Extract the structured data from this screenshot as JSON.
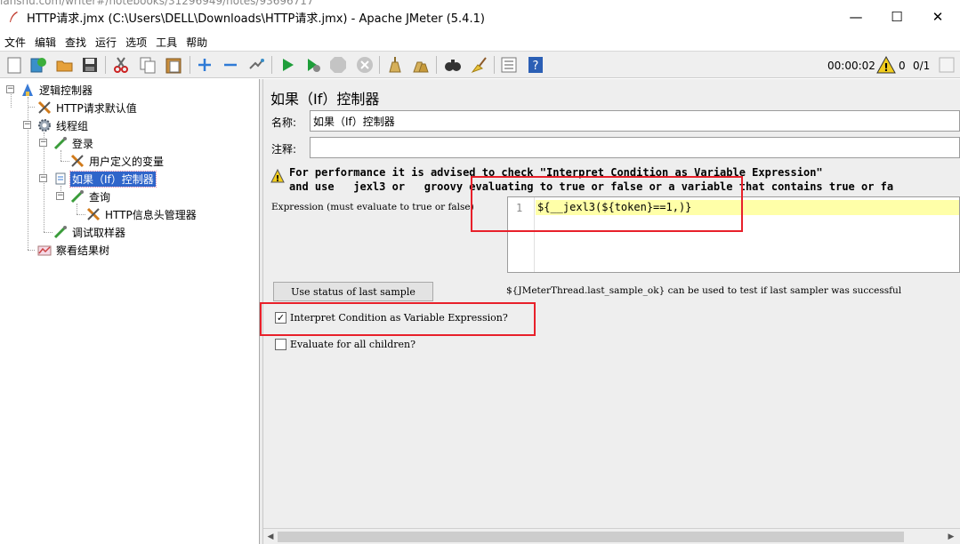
{
  "url_overlay": "ianshu.com/writer#/notebooks/31296949/notes/93696717",
  "window": {
    "title": "HTTP请求.jmx (C:\\Users\\DELL\\Downloads\\HTTP请求.jmx) - Apache JMeter (5.4.1)",
    "minimize": "—",
    "maximize": "☐",
    "close": "✕"
  },
  "menu": [
    "文件",
    "编辑",
    "查找",
    "运行",
    "选项",
    "工具",
    "帮助"
  ],
  "toolbar": {
    "timer": "00:00:02",
    "warning_count": "0",
    "threads": "0/1"
  },
  "tree": [
    {
      "label": "逻辑控制器",
      "icon": "test-plan-icon"
    },
    {
      "label": "HTTP请求默认值",
      "icon": "wrench-icon"
    },
    {
      "label": "线程组",
      "icon": "gear-icon"
    },
    {
      "label": "登录",
      "icon": "sampler-icon"
    },
    {
      "label": "用户定义的变量",
      "icon": "wrench-icon"
    },
    {
      "label": "如果（If）控制器",
      "icon": "controller-icon"
    },
    {
      "label": "查询",
      "icon": "sampler-icon"
    },
    {
      "label": "HTTP信息头管理器",
      "icon": "wrench-icon"
    },
    {
      "label": "调试取样器",
      "icon": "sampler-icon"
    },
    {
      "label": "察看结果树",
      "icon": "chart-icon"
    }
  ],
  "panel": {
    "title": "如果（If）控制器",
    "name_label": "名称:",
    "name_value": "如果（If）控制器",
    "comment_label": "注释:",
    "comment_value": "",
    "warning_line1": "For performance it is advised to check \"Interpret Condition as Variable Expression\"",
    "warning_line2": "and use   jexl3 or   groovy evaluating to true or false or a variable that contains true or fa",
    "expression_label": "Expression (must evaluate to true or false)",
    "line_number": "1",
    "expression_value": "${__jexl3(${token}==1,)}",
    "use_status_button": "Use status of last sample",
    "hint": "${JMeterThread.last_sample_ok} can be used to test if last sampler was successful",
    "interpret_label": "Interpret Condition as Variable Expression?",
    "interpret_checked": "✓",
    "evaluate_label": "Evaluate for all children?",
    "evaluate_checked": ""
  }
}
